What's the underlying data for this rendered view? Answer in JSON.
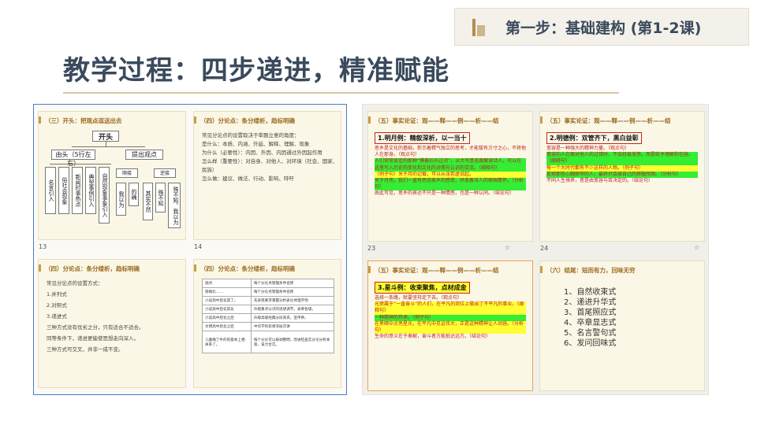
{
  "title": "教学过程：四步递进，精准赋能",
  "step_badge": "第一步：基础建构 (第1-2课)",
  "left": {
    "c1": {
      "header": "（三）开头：把观点逗送出去",
      "root": "开头",
      "b1": "由头（5行左右）",
      "b2": "提出观点",
      "leaves1": [
        "名言引入",
        "俗社会现象",
        "新闻时事热点",
        "典型事例引入",
        "自然现象事象引入"
      ],
      "sub1": "顺接",
      "sub2": "逆接",
      "leaves2": [
        "我以为",
        "的确",
        "其实不然",
        "殊不知",
        "殊不知，我以为"
      ]
    },
    "c2": {
      "header": "（四）分论点：条分缕析，趋标明确",
      "lines": [
        "常见分论点的设置取决于审题立意的角度：",
        "是什么：本质、内涵、外延、解释、理解、现象",
        "为什么（必要性）：内因、外因、内因通过外因起作用",
        "怎么样（重要性）：对自身、对他人、对环境（社会、国家、民族）",
        "怎么做：建议、做法、行动、影响、呼吁"
      ],
      "num": "14"
    },
    "n13": "13",
    "c3": {
      "header": "（四）分论点：条分缕析，趋标明确",
      "lines": [
        "常见分论点的设置方式：",
        "1.并列式",
        "2.对照式",
        "3.递进式",
        "三种方式没有优劣之分，只有适合不适合。",
        "同等条件下，递进更能使思想走向深入。",
        "三种方式可交叉，并非一成不变。"
      ]
    },
    "c4": {
      "header": "（四）分论点：条分缕析，趋标明确",
      "rows": [
        [
          "观点",
          "每个分论点管理条件名称"
        ],
        [
          "隐喻比……",
          "每个分论点管理条件名称"
        ],
        [
          "小说高中后化其了。",
          "先表现要求掌握分析表论体理学领"
        ],
        [
          "小说高中后化其化",
          "升级重点认识的思想调节，表养各级。"
        ],
        [
          "小说高中后化之后",
          "升级高级经典分段资讯，宣传养。"
        ],
        [
          "文明高中后化之后",
          "中华学的思想深层次讲"
        ],
        [
          "儿童确了牛的的基本上相关系了。",
          "每个分论可以按调整明，改进检查实分论分析本第，该力合实。"
        ]
      ]
    }
  },
  "right": {
    "c1": {
      "header": "（五）事实论证：观——释——例——析——结",
      "sub": "1.明月例：精叙深析，以一当十",
      "p": [
        "思乡是文化的基础，彰示着精气独立的思考，才能拔有方寸之心，不将他人在那身。（观点句）",
        "人们常常肯定的那种“摸着石头过河”，以大写意态度解读诗人，可以在这里写入历史的变化和文化的对照与认识的交流。（阐释句）",
        "（例子句）关于月的记载，可以从张若虚说起。",
        "关于月亮，我们一直有思念家乡的感受，抒发着诗人的家国情怀。（分析句）",
        "由此可见，思乡的表达不只是一种情感，也是一种认同。（结论句）"
      ],
      "num": "23"
    },
    "c2": {
      "header": "（五）事实论证：观——释——例——析——结",
      "sub": "2.明德例：双管齐下，黑白益彰",
      "p": [
        "宽容是一种强大的精神力量。（观点句）",
        "宽容的人在面对他人的过错时，不会轻易发怒，而是给予理解和包容。（阐释句）",
        "每一个大时代都有不少这样的人物。（例子句）",
        "反观那些心胸狭窄的人，最终只会被自己的狭隘所困。（分析句）",
        "不同人生境界，皆是由宽容与否决定的。（结论句）"
      ],
      "num": "24"
    },
    "c3": {
      "header": "（五）事实论证：观——释——例——析——结",
      "sub": "3.星斗例：收束聚焦，点材成金",
      "p": [
        "选择一条路，就要坚持走下去。（观点句）",
        "光荣属于“一直奋斗”的人们，在平凡的岗位上做出了不平凡的事业。（阐释句）",
        "一种精神的传承。（例子句）",
        "在黑暗中点亮星光，在平凡中见证伟大，正是这种精神让人动容。（分析句）",
        "生命的意义在于奉献，奋斗者方能抵达远方。（结论句）"
      ]
    },
    "c4": {
      "header": "（六）结尾：短而有力，回味无穷",
      "items": [
        "1、自然收束式",
        "2、递进升华式",
        "3、首尾照应式",
        "4、卒章显志式",
        "5、名言警句式",
        "6、发问回味式"
      ]
    }
  },
  "colors": {
    "accent": "#3a4a5c",
    "gold": "#b08f4d",
    "selected_border": "#4b7cc5",
    "orange_border": "#f0a050"
  }
}
